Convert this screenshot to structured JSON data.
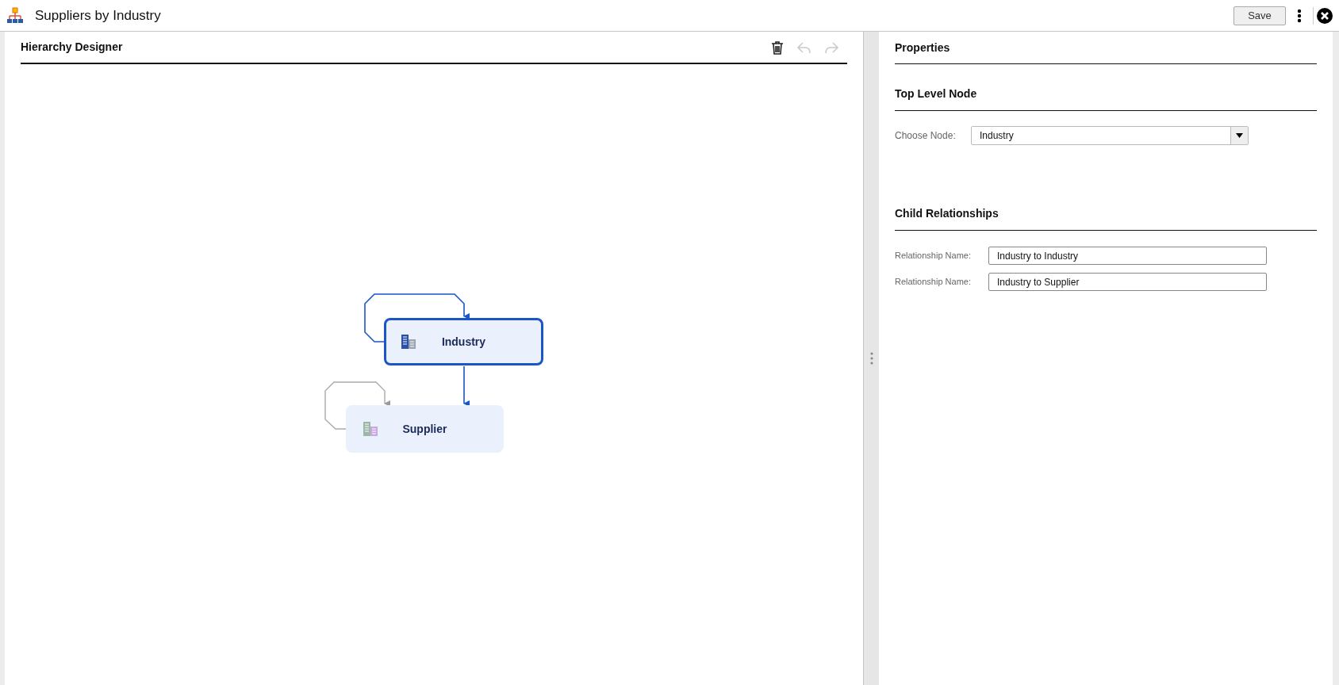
{
  "window": {
    "title": "Suppliers by Industry",
    "save_button": "Save"
  },
  "designer": {
    "title": "Hierarchy Designer",
    "toolbar": [
      {
        "kind": "delete",
        "disabled": false
      },
      {
        "kind": "undo",
        "disabled": true
      },
      {
        "kind": "redo",
        "disabled": true
      }
    ],
    "nodes": [
      {
        "label": "Industry",
        "selected": true
      },
      {
        "label": "Supplier",
        "selected": false
      }
    ]
  },
  "properties": {
    "title": "Properties",
    "top_level": {
      "title": "Top Level Node",
      "label": "Choose Node:",
      "value": "Industry"
    },
    "child_relationships": {
      "title": "Child Relationships",
      "rows": [
        {
          "label": "Relationship Name:",
          "value": "Industry to Industry"
        },
        {
          "label": "Relationship Name:",
          "value": "Industry to Supplier"
        }
      ]
    }
  }
}
